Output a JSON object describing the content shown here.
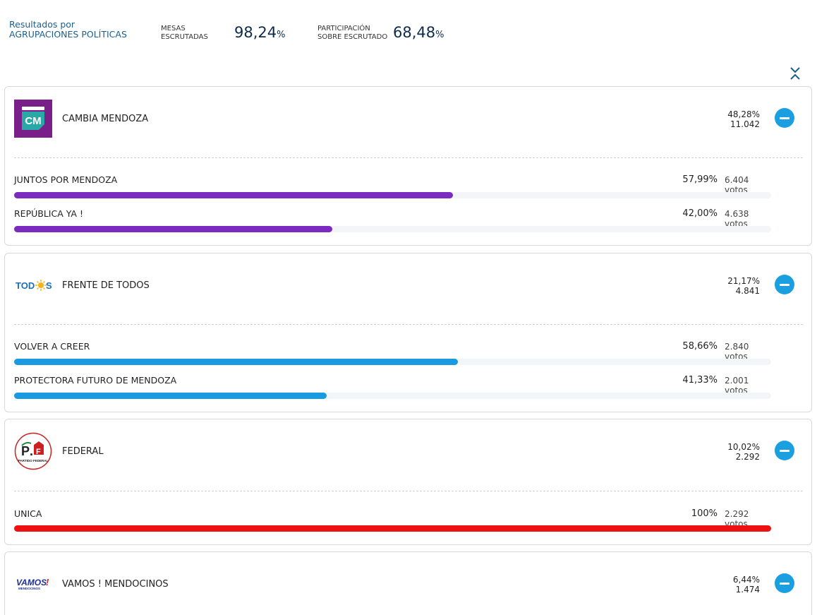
{
  "header": {
    "title_line1": "Resultados por",
    "title_line2": "AGRUPACIONES POLÍTICAS",
    "mesas_label_1": "MESAS",
    "mesas_label_2": "ESCRUTADAS",
    "mesas_value": "98,24",
    "participacion_label_1": "PARTICIPACIÓN",
    "participacion_label_2": "SOBRE ESCRUTADO",
    "participacion_value": "68,48",
    "percent_sign": "%"
  },
  "colors": {
    "accent_blue": "#1a9fe0",
    "cambia_purple": "#7b2bbf",
    "todos_blue": "#1a9be0",
    "federal_red": "#ee1111"
  },
  "parties": [
    {
      "name": "CAMBIA MENDOZA",
      "logo_text": "CM",
      "logo_icon": "cambia-mendoza-logo",
      "pct": "48,28%",
      "votes": "11.042",
      "lists": [
        {
          "name": "JUNTOS POR MENDOZA",
          "pct": "57,99%",
          "votes": "6.404 votos",
          "share": 0.5799
        },
        {
          "name": "REPÚBLICA YA !",
          "pct": "42,00%",
          "votes": "4.638 votos",
          "share": 0.42
        }
      ]
    },
    {
      "name": "FRENTE DE TODOS",
      "logo_text": "TODOS",
      "logo_icon": "frente-de-todos-logo",
      "pct": "21,17%",
      "votes": "4.841",
      "lists": [
        {
          "name": "VOLVER A CREER",
          "pct": "58,66%",
          "votes": "2.840 votos",
          "share": 0.5866
        },
        {
          "name": "PROTECTORA FUTURO DE MENDOZA",
          "pct": "41,33%",
          "votes": "2.001 votos",
          "share": 0.4133
        }
      ]
    },
    {
      "name": "FEDERAL",
      "logo_text": "P.F",
      "logo_subtext": "PARTIDO FEDERAL",
      "logo_icon": "partido-federal-logo",
      "pct": "10,02%",
      "votes": "2.292",
      "lists": [
        {
          "name": "UNICA",
          "pct": "100%",
          "votes": "2.292 votos",
          "share": 1.0
        }
      ]
    },
    {
      "name": "VAMOS ! MENDOCINOS",
      "logo_text": "VAMOS!",
      "logo_subtext": "MENDOCINOS",
      "logo_icon": "vamos-mendocinos-logo",
      "pct": "6,44%",
      "votes": "1.474",
      "lists": []
    }
  ],
  "icons": {
    "collapse_all": "collapse-all-icon",
    "toggle": "minus-circle-icon"
  }
}
